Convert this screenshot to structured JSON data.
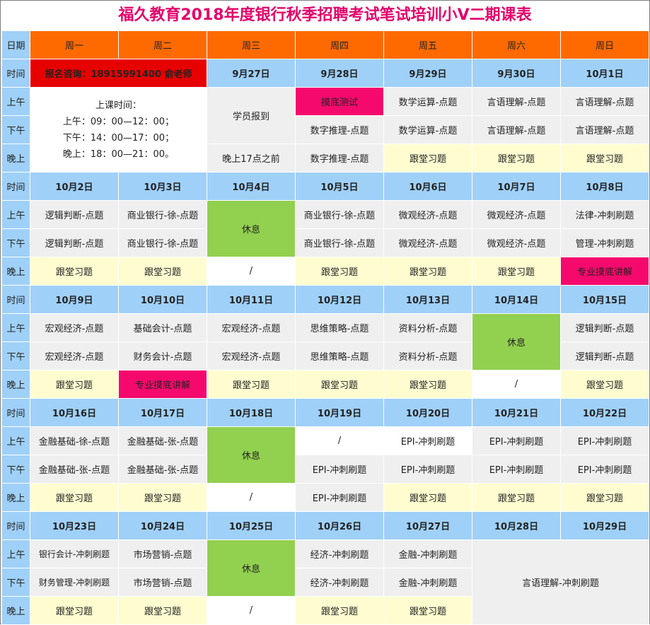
{
  "title": "福久教育2018年度银行秋季招聘考试笔试培训小V二期课表",
  "labels": {
    "date": "日期",
    "time": "时间",
    "am": "上午",
    "pm": "下午",
    "eve": "晚上"
  },
  "days": [
    "周一",
    "周二",
    "周三",
    "周四",
    "周五",
    "周六",
    "周日"
  ],
  "week1": {
    "contact": "报名咨询：18915991400 俞老师",
    "dates": [
      "9月27日",
      "9月28日",
      "9月29日",
      "9月30日",
      "10月1日"
    ],
    "class_time": {
      "heading": "上课时间：",
      "morning": "上午：09：00—12：00；",
      "afternoon": "下午：14：00—17：00；",
      "evening": "晚上：18：00—21：00。"
    },
    "checkin": "学员报到",
    "checkin_note": "晚上17点之前",
    "am": [
      "摸底测试",
      "数学运算-点题",
      "言语理解-点题",
      "言语理解-点题"
    ],
    "pm": [
      "数字推理-点题",
      "数学运算-点题",
      "言语理解-点题",
      "言语理解-点题"
    ],
    "eve": [
      "数字推理-点题",
      "跟堂习题",
      "跟堂习题",
      "跟堂习题"
    ]
  },
  "week2": {
    "dates": [
      "10月2日",
      "10月3日",
      "10月4日",
      "10月5日",
      "10月6日",
      "10月7日",
      "10月8日"
    ],
    "am": [
      "逻辑判断-点题",
      "商业银行-徐-点题",
      "休息",
      "商业银行-徐-点题",
      "微观经济-点题",
      "微观经济-点题",
      "法律-冲刺刷题"
    ],
    "pm": [
      "逻辑判断-点题",
      "商业银行-徐-点题",
      "商业银行-徐-点题",
      "微观经济-点题",
      "微观经济-点题",
      "管理-冲刺刷题"
    ],
    "eve": [
      "跟堂习题",
      "跟堂习题",
      "/",
      "跟堂习题",
      "跟堂习题",
      "跟堂习题",
      "专业摸底讲解"
    ]
  },
  "week3": {
    "dates": [
      "10月9日",
      "10月10日",
      "10月11日",
      "10月12日",
      "10月13日",
      "10月14日",
      "10月15日"
    ],
    "am": [
      "宏观经济-点题",
      "基础会计-点题",
      "宏观经济-点题",
      "思维策略-点题",
      "资料分析-点题",
      "休息",
      "逻辑判断-点题"
    ],
    "pm": [
      "宏观经济-点题",
      "财务会计-点题",
      "宏观经济-点题",
      "思维策略-点题",
      "资料分析-点题",
      "逻辑判断-点题"
    ],
    "eve": [
      "跟堂习题",
      "专业摸底讲解",
      "跟堂习题",
      "跟堂习题",
      "跟堂习题",
      "/",
      "跟堂习题"
    ]
  },
  "week4": {
    "dates": [
      "10月16日",
      "10月17日",
      "10月18日",
      "10月19日",
      "10月20日",
      "10月21日",
      "10月22日"
    ],
    "am": [
      "金融基础-徐-点题",
      "金融基础-张-点题",
      "休息",
      "/",
      "EPI-冲刺刷题",
      "EPI-冲刺刷题",
      "EPI-冲刺刷题"
    ],
    "pm": [
      "金融基础-张-点题",
      "金融基础-张-点题",
      "EPI-冲刺刷题",
      "EPI-冲刺刷题",
      "EPI-冲刺刷题",
      "EPI-冲刺刷题"
    ],
    "eve": [
      "跟堂习题",
      "跟堂习题",
      "/",
      "EPI-冲刺刷题",
      "跟堂习题",
      "跟堂习题",
      "跟堂习题"
    ]
  },
  "week5": {
    "dates": [
      "10月23日",
      "10月24日",
      "10月25日",
      "10月26日",
      "10月27日",
      "10月28日",
      "10月29日"
    ],
    "am": [
      "银行会计-冲刺刷题",
      "市场营销-点题",
      "休息",
      "经济-冲刺刷题",
      "金融-冲刺刷题",
      "言语理解-冲刺刷题"
    ],
    "pm": [
      "财务管理-冲刺刷题",
      "市场营销-点题",
      "经济-冲刺刷题",
      "金融-冲刺刷题"
    ],
    "eve": [
      "跟堂习题",
      "跟堂习题",
      "/",
      "跟堂习题",
      "跟堂习题"
    ]
  }
}
